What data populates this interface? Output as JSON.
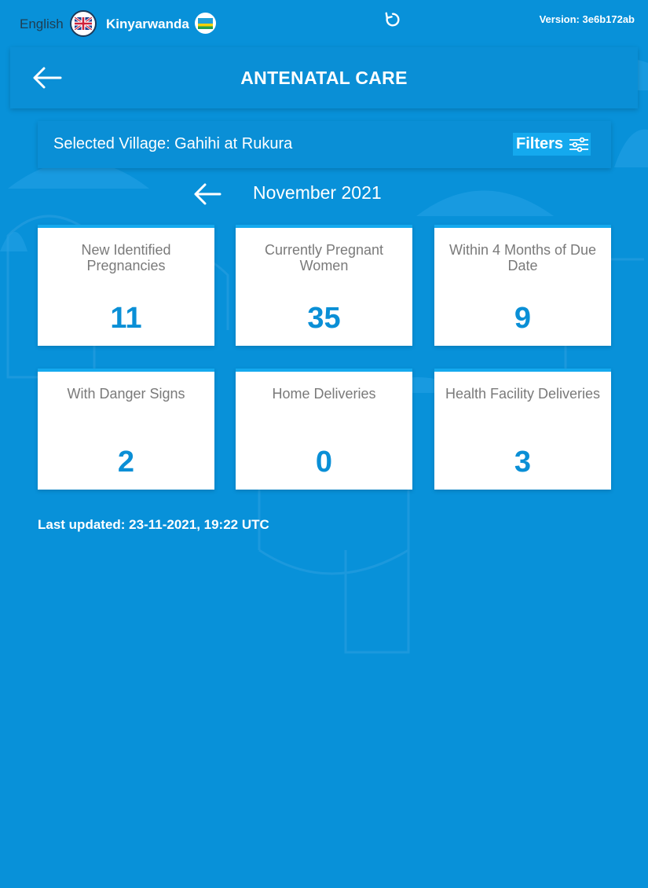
{
  "topbar": {
    "lang_english": "English",
    "lang_kinyarwanda": "Kinyarwanda",
    "version": "Version: 3e6b172ab"
  },
  "header": {
    "title": "ANTENATAL CARE"
  },
  "village": {
    "label": "Selected Village: Gahihi at Rukura",
    "filters_label": "Filters"
  },
  "period": {
    "month": "November 2021"
  },
  "cards": [
    {
      "title": "New Identified Pregnancies",
      "value": "11"
    },
    {
      "title": "Currently Pregnant Women",
      "value": "35"
    },
    {
      "title": "Within 4 Months of Due Date",
      "value": "9"
    },
    {
      "title": "With Danger Signs",
      "value": "2"
    },
    {
      "title": "Home Deliveries",
      "value": "0"
    },
    {
      "title": "Health Facility Deliveries",
      "value": "3"
    }
  ],
  "footer": {
    "last_updated": "Last updated: 23-11-2021, 19:22 UTC"
  },
  "colors": {
    "background": "#0891d9",
    "accent": "#14a9ee",
    "value_text": "#0a8fd6"
  },
  "icons": [
    "uk-flag-icon",
    "rwanda-flag-icon",
    "refresh-icon",
    "back-arrow-icon",
    "filter-sliders-icon"
  ]
}
